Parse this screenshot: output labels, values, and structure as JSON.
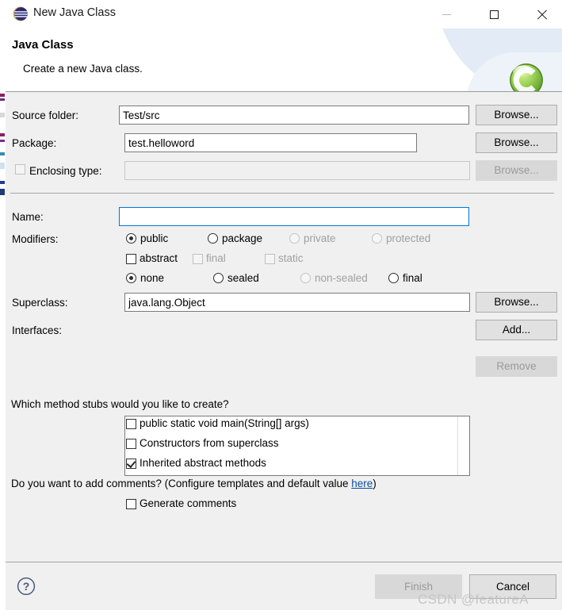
{
  "window": {
    "title": "New Java Class",
    "icon": "eclipse-logo-icon",
    "controls": {
      "minimize": "minimize-icon",
      "maximize": "maximize-icon",
      "close": "close-icon"
    }
  },
  "header": {
    "title": "Java Class",
    "description": "Create a new Java class.",
    "icon": "java-class-icon"
  },
  "form": {
    "source_folder": {
      "label": "Source folder:",
      "value": "Test/src",
      "placeholder": "",
      "browse_label": "Browse..."
    },
    "package": {
      "label": "Package:",
      "value": "test.helloword",
      "placeholder": "",
      "browse_label": "Browse..."
    },
    "enclosing_type": {
      "label": "Enclosing type:",
      "checked": false,
      "enabled": false,
      "value": "",
      "placeholder": "",
      "browse_label": "Browse..."
    },
    "name": {
      "label": "Name:",
      "value": "",
      "placeholder": "",
      "focused": true
    },
    "modifiers": {
      "label": "Modifiers:",
      "access": [
        {
          "label": "public",
          "selected": true,
          "enabled": true
        },
        {
          "label": "package",
          "selected": false,
          "enabled": true
        },
        {
          "label": "private",
          "selected": false,
          "enabled": false
        },
        {
          "label": "protected",
          "selected": false,
          "enabled": false
        }
      ],
      "flags": [
        {
          "label": "abstract",
          "checked": false,
          "enabled": true
        },
        {
          "label": "final",
          "checked": false,
          "enabled": false
        },
        {
          "label": "static",
          "checked": false,
          "enabled": false
        }
      ],
      "sealed": [
        {
          "label": "none",
          "selected": true,
          "enabled": true
        },
        {
          "label": "sealed",
          "selected": false,
          "enabled": true
        },
        {
          "label": "non-sealed",
          "selected": false,
          "enabled": false
        },
        {
          "label": "final",
          "selected": false,
          "enabled": true
        }
      ]
    },
    "superclass": {
      "label": "Superclass:",
      "value": "java.lang.Object",
      "placeholder": "",
      "browse_label": "Browse..."
    },
    "interfaces": {
      "label": "Interfaces:",
      "items": [],
      "add_label": "Add...",
      "remove_label": "Remove",
      "remove_enabled": false
    }
  },
  "stubs": {
    "question": "Which method stubs would you like to create?",
    "options": [
      {
        "label": "public static void main(String[] args)",
        "checked": false
      },
      {
        "label": "Constructors from superclass",
        "checked": false
      },
      {
        "label": "Inherited abstract methods",
        "checked": true
      }
    ]
  },
  "comments": {
    "question_prefix": "Do you want to add comments? (Configure templates and default value ",
    "link_text": "here",
    "question_suffix": ")",
    "option": {
      "label": "Generate comments",
      "checked": false
    }
  },
  "footer": {
    "help_icon": "help-icon",
    "finish_label": "Finish",
    "finish_enabled": false,
    "cancel_label": "Cancel"
  },
  "watermark": "CSDN @featureA",
  "colors": {
    "dialog_bg": "#f0f0f0",
    "header_bg": "#ffffff",
    "accent_focus": "#0078d7",
    "link": "#0b4f9e",
    "class_icon_green": "#7ac143",
    "watermark": "#c6c6c6",
    "disabled_text": "#a0a0a0"
  }
}
